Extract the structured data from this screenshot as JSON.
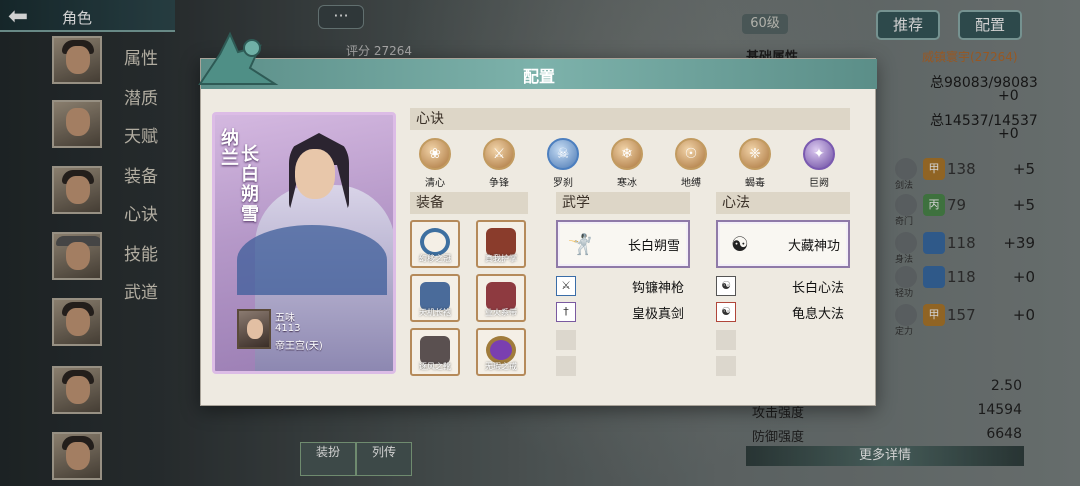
{
  "header": {
    "title": "角色",
    "chat_glyph": "···"
  },
  "sidebar": {
    "tabs": [
      "属性",
      "潜质",
      "天赋",
      "装备",
      "心诀",
      "技能",
      "武道"
    ],
    "portrait_count": 7
  },
  "background": {
    "level_badge": "60级",
    "recommend_btn": "推荐",
    "config_btn": "配置",
    "score": "评分 27264",
    "section_title": "基础属性",
    "power_label": "威镇寰宇(27264)",
    "hp_total": "总98083/98083",
    "hp_plus": "+0",
    "mp_total": "总14537/14537",
    "mp_plus": "+0",
    "stat_rows": [
      {
        "label": "剑法",
        "badge": "甲",
        "value": "138",
        "plus": "+5"
      },
      {
        "label": "奇门",
        "badge": "丙",
        "value": "79",
        "plus": "+5"
      },
      {
        "label": "身法",
        "badge": "",
        "value": "118",
        "plus": "+39"
      },
      {
        "label": "轻功",
        "badge": "",
        "value": "118",
        "plus": "+0"
      },
      {
        "label": "定力",
        "badge": "甲",
        "value": "157",
        "plus": "+0"
      }
    ],
    "bottom_stats": [
      {
        "label": "",
        "value": "2.50"
      },
      {
        "label": "攻击强度",
        "value": "14594"
      },
      {
        "label": "防御强度",
        "value": "6648"
      }
    ],
    "more_details": "更多详情",
    "bottom_tabs": [
      "装扮",
      "列传"
    ]
  },
  "modal": {
    "title": "配置",
    "hero": {
      "name_side": "纳兰",
      "name_main": "长白朔雪",
      "user_name": "五味",
      "user_power": "4113",
      "user_guild": "帝王宫(天)"
    },
    "xinjue": {
      "header": "心诀",
      "items": [
        {
          "label": "清心",
          "color": "#c68d48"
        },
        {
          "label": "争锋",
          "color": "#c68d48"
        },
        {
          "label": "罗刹",
          "color": "#5c8fc8"
        },
        {
          "label": "寒冰",
          "color": "#c68d48"
        },
        {
          "label": "地缚",
          "color": "#c68d48"
        },
        {
          "label": "蝎毒",
          "color": "#c68d48"
        },
        {
          "label": "巨阙",
          "color": "#7a5ab0"
        }
      ]
    },
    "equipment": {
      "header": "装备",
      "items": [
        {
          "label": "幻移之冠",
          "color": "#3d6fa0"
        },
        {
          "label": "真我护掌",
          "color": "#8a3c2c"
        },
        {
          "label": "天机长袍",
          "color": "#4a6b9a"
        },
        {
          "label": "业火系带",
          "color": "#8e3a40"
        },
        {
          "label": "逐风之靴",
          "color": "#5a5050"
        },
        {
          "label": "无瑕之戒",
          "color": "#7a3fb0"
        }
      ]
    },
    "wuxue": {
      "header": "武学",
      "main": "长白朔雪",
      "subs": [
        "钩镰神枪",
        "皇极真剑"
      ]
    },
    "xinfa": {
      "header": "心法",
      "main": "大藏神功",
      "subs": [
        "长白心法",
        "龟息大法"
      ]
    }
  }
}
